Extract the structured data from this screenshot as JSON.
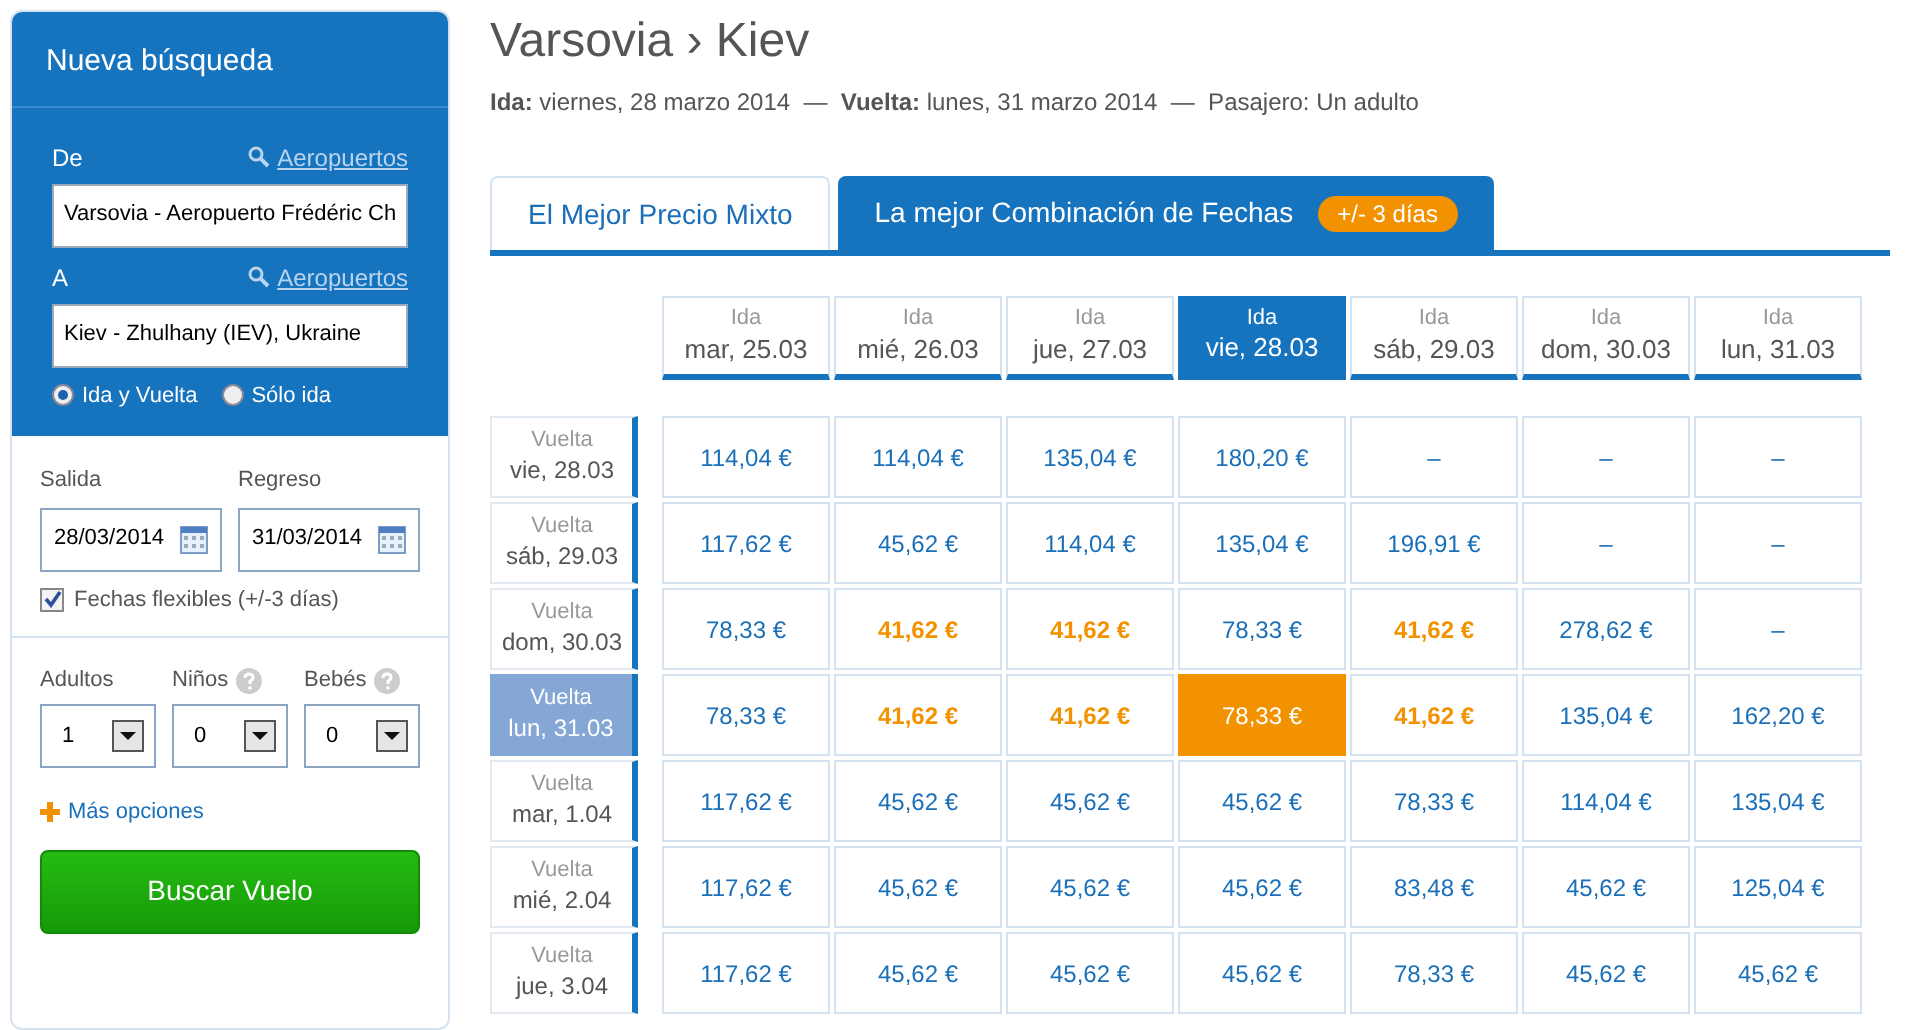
{
  "search_panel": {
    "title": "Nueva búsqueda",
    "from": {
      "label": "De",
      "link": "Aeropuertos",
      "value": "Varsovia  - Aeropuerto Frédéric Ch"
    },
    "to": {
      "label": "A",
      "link": "Aeropuertos",
      "value": "Kiev - Zhulhany (IEV), Ukraine"
    },
    "trip_types": [
      {
        "label": "Ida y Vuelta",
        "selected": true
      },
      {
        "label": "Sólo ida",
        "selected": false
      }
    ],
    "departure": {
      "label": "Salida",
      "value": "28/03/2014"
    },
    "return": {
      "label": "Regreso",
      "value": "31/03/2014"
    },
    "flexible": {
      "label": "Fechas flexibles (+/-3 días)",
      "checked": true
    },
    "passengers": [
      {
        "label": "Adultos",
        "help": false,
        "value": "1"
      },
      {
        "label": "Niños",
        "help": true,
        "value": "0"
      },
      {
        "label": "Bebés",
        "help": true,
        "value": "0"
      }
    ],
    "more_options": "Más opciones",
    "search_button": "Buscar Vuelo"
  },
  "route": {
    "title": "Varsovia › Kiev",
    "summary": "**Ida:** viernes, 28 marzo 2014  —  **Vuelta:** lunes, 31 marzo 2014  —  Pasajero: Un adulto"
  },
  "tabs": [
    {
      "label": "El Mejor Precio Mixto",
      "selected": false
    },
    {
      "label": "La mejor Combinación de Fechas",
      "badge": "+/- 3 días",
      "selected": true
    }
  ],
  "grid": {
    "columns": [
      {
        "caption": "Ida",
        "date": "mar, 25.03",
        "selected": false
      },
      {
        "caption": "Ida",
        "date": "mié, 26.03",
        "selected": false
      },
      {
        "caption": "Ida",
        "date": "jue, 27.03",
        "selected": false
      },
      {
        "caption": "Ida",
        "date": "vie, 28.03",
        "selected": true
      },
      {
        "caption": "Ida",
        "date": "sáb, 29.03",
        "selected": false
      },
      {
        "caption": "Ida",
        "date": "dom, 30.03",
        "selected": false
      },
      {
        "caption": "Ida",
        "date": "lun, 31.03",
        "selected": false
      }
    ],
    "rows": [
      {
        "caption": "Vuelta",
        "date": "vie, 28.03",
        "selected": false,
        "cells": [
          {
            "text": "114,04 €",
            "cheapest": false,
            "selected": false
          },
          {
            "text": "114,04 €",
            "cheapest": false,
            "selected": false
          },
          {
            "text": "135,04 €",
            "cheapest": false,
            "selected": false
          },
          {
            "text": "180,20 €",
            "cheapest": false,
            "selected": false
          },
          {
            "text": "–",
            "cheapest": false,
            "selected": false
          },
          {
            "text": "–",
            "cheapest": false,
            "selected": false
          },
          {
            "text": "–",
            "cheapest": false,
            "selected": false
          }
        ]
      },
      {
        "caption": "Vuelta",
        "date": "sáb, 29.03",
        "selected": false,
        "cells": [
          {
            "text": "117,62 €",
            "cheapest": false,
            "selected": false
          },
          {
            "text": "45,62 €",
            "cheapest": false,
            "selected": false
          },
          {
            "text": "114,04 €",
            "cheapest": false,
            "selected": false
          },
          {
            "text": "135,04 €",
            "cheapest": false,
            "selected": false
          },
          {
            "text": "196,91 €",
            "cheapest": false,
            "selected": false
          },
          {
            "text": "–",
            "cheapest": false,
            "selected": false
          },
          {
            "text": "–",
            "cheapest": false,
            "selected": false
          }
        ]
      },
      {
        "caption": "Vuelta",
        "date": "dom, 30.03",
        "selected": false,
        "cells": [
          {
            "text": "78,33 €",
            "cheapest": false,
            "selected": false
          },
          {
            "text": "41,62 €",
            "cheapest": true,
            "selected": false
          },
          {
            "text": "41,62 €",
            "cheapest": true,
            "selected": false
          },
          {
            "text": "78,33 €",
            "cheapest": false,
            "selected": false
          },
          {
            "text": "41,62 €",
            "cheapest": true,
            "selected": false
          },
          {
            "text": "278,62 €",
            "cheapest": false,
            "selected": false
          },
          {
            "text": "–",
            "cheapest": false,
            "selected": false
          }
        ]
      },
      {
        "caption": "Vuelta",
        "date": "lun, 31.03",
        "selected": true,
        "cells": [
          {
            "text": "78,33 €",
            "cheapest": false,
            "selected": false
          },
          {
            "text": "41,62 €",
            "cheapest": true,
            "selected": false
          },
          {
            "text": "41,62 €",
            "cheapest": true,
            "selected": false
          },
          {
            "text": "78,33 €",
            "cheapest": false,
            "selected": true
          },
          {
            "text": "41,62 €",
            "cheapest": true,
            "selected": false
          },
          {
            "text": "135,04 €",
            "cheapest": false,
            "selected": false
          },
          {
            "text": "162,20 €",
            "cheapest": false,
            "selected": false
          }
        ]
      },
      {
        "caption": "Vuelta",
        "date": "mar, 1.04",
        "selected": false,
        "cells": [
          {
            "text": "117,62 €",
            "cheapest": false,
            "selected": false
          },
          {
            "text": "45,62 €",
            "cheapest": false,
            "selected": false
          },
          {
            "text": "45,62 €",
            "cheapest": false,
            "selected": false
          },
          {
            "text": "45,62 €",
            "cheapest": false,
            "selected": false
          },
          {
            "text": "78,33 €",
            "cheapest": false,
            "selected": false
          },
          {
            "text": "114,04 €",
            "cheapest": false,
            "selected": false
          },
          {
            "text": "135,04 €",
            "cheapest": false,
            "selected": false
          }
        ]
      },
      {
        "caption": "Vuelta",
        "date": "mié, 2.04",
        "selected": false,
        "cells": [
          {
            "text": "117,62 €",
            "cheapest": false,
            "selected": false
          },
          {
            "text": "45,62 €",
            "cheapest": false,
            "selected": false
          },
          {
            "text": "45,62 €",
            "cheapest": false,
            "selected": false
          },
          {
            "text": "45,62 €",
            "cheapest": false,
            "selected": false
          },
          {
            "text": "83,48 €",
            "cheapest": false,
            "selected": false
          },
          {
            "text": "45,62 €",
            "cheapest": false,
            "selected": false
          },
          {
            "text": "125,04 €",
            "cheapest": false,
            "selected": false
          }
        ]
      },
      {
        "caption": "Vuelta",
        "date": "jue, 3.04",
        "selected": false,
        "cells": [
          {
            "text": "117,62 €",
            "cheapest": false,
            "selected": false
          },
          {
            "text": "45,62 €",
            "cheapest": false,
            "selected": false
          },
          {
            "text": "45,62 €",
            "cheapest": false,
            "selected": false
          },
          {
            "text": "45,62 €",
            "cheapest": false,
            "selected": false
          },
          {
            "text": "78,33 €",
            "cheapest": false,
            "selected": false
          },
          {
            "text": "45,62 €",
            "cheapest": false,
            "selected": false
          },
          {
            "text": "45,62 €",
            "cheapest": false,
            "selected": false
          }
        ]
      }
    ]
  }
}
